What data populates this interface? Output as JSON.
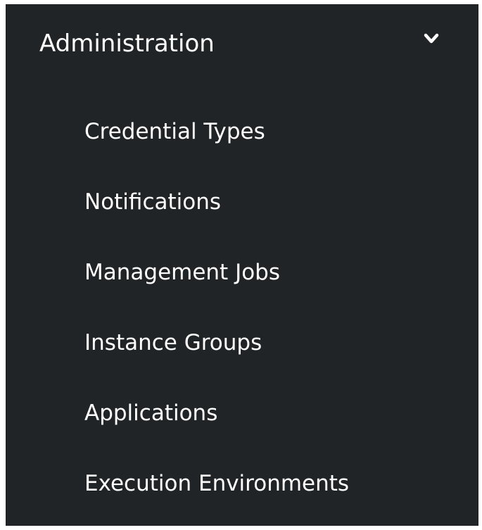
{
  "nav": {
    "group": {
      "title": "Administration",
      "expanded": true,
      "toggle_icon": "chevron-down-icon"
    },
    "items": [
      {
        "label": "Credential Types"
      },
      {
        "label": "Notifications"
      },
      {
        "label": "Management Jobs"
      },
      {
        "label": "Instance Groups"
      },
      {
        "label": "Applications"
      },
      {
        "label": "Execution Environments"
      }
    ]
  },
  "colors": {
    "panel_background": "#212427",
    "text": "#ffffff"
  }
}
